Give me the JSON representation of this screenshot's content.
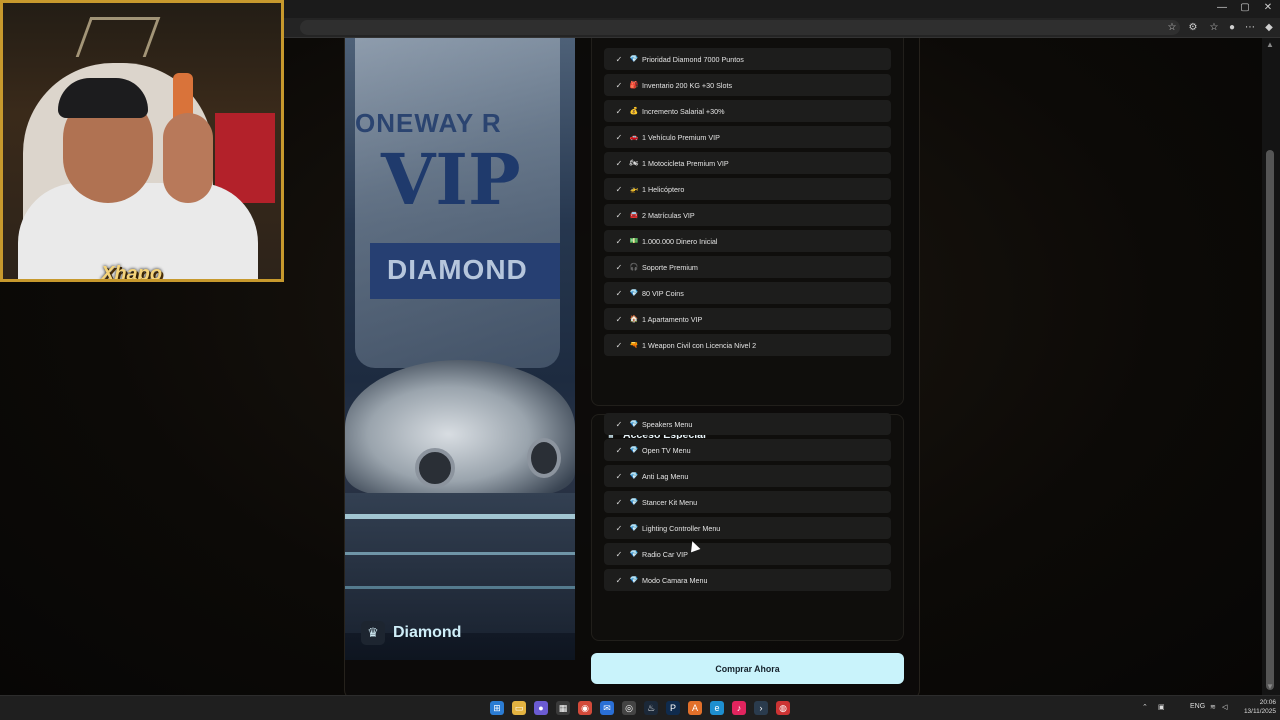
{
  "browser": {
    "window_controls": [
      "—",
      "▢",
      "✕"
    ],
    "toolbar_icons": [
      "star-icon",
      "extensions-icon",
      "favorites-icon",
      "profile-icon",
      "menu-icon",
      "copilot-icon"
    ]
  },
  "webcam": {
    "streamer_name": "Xhapo"
  },
  "product": {
    "name": "Diamond",
    "hero_brand": "ONEWAY R",
    "hero_vip": "VIP",
    "hero_band": "DIAMOND",
    "benefits": [
      {
        "emoji": "💎",
        "label": "Prioridad Diamond 7000 Puntos"
      },
      {
        "emoji": "🎒",
        "label": "Inventario 200 KG +30 Slots"
      },
      {
        "emoji": "💰",
        "label": "Incremento Salarial +30%"
      },
      {
        "emoji": "🚗",
        "label": "1 Vehículo Premium VIP"
      },
      {
        "emoji": "🏍",
        "label": "1 Motocicleta Premium VIP"
      },
      {
        "emoji": "🚁",
        "label": "1 Helicóptero"
      },
      {
        "emoji": "🚘",
        "label": "2 Matrículas VIP"
      },
      {
        "emoji": "💵",
        "label": "1.000.000 Dinero Inicial"
      },
      {
        "emoji": "🎧",
        "label": "Soporte Premium"
      },
      {
        "emoji": "💎",
        "label": "80 VIP Coins"
      },
      {
        "emoji": "🏠",
        "label": "1 Apartamento VIP"
      },
      {
        "emoji": "🔫",
        "label": "1 Weapon Civil con Licencia Nivel 2"
      }
    ],
    "special_access": {
      "title": "Acceso Especial",
      "items": [
        {
          "emoji": "💎",
          "label": "Speakers Menu"
        },
        {
          "emoji": "💎",
          "label": "Open TV Menu"
        },
        {
          "emoji": "💎",
          "label": "Anti Lag Menu"
        },
        {
          "emoji": "💎",
          "label": "Stancer Kit Menu"
        },
        {
          "emoji": "💎",
          "label": "Lighting Controller Menu"
        },
        {
          "emoji": "💎",
          "label": "Radio Car VIP"
        },
        {
          "emoji": "💎",
          "label": "Modo Camara Menu"
        }
      ]
    },
    "buy_label": "Comprar Ahora"
  },
  "taskbar": {
    "lang": "ENG",
    "time": "20:06",
    "date": "13/11/2025"
  },
  "colors": {
    "accent": "#c9f3fb",
    "frame": "#c7992d"
  }
}
